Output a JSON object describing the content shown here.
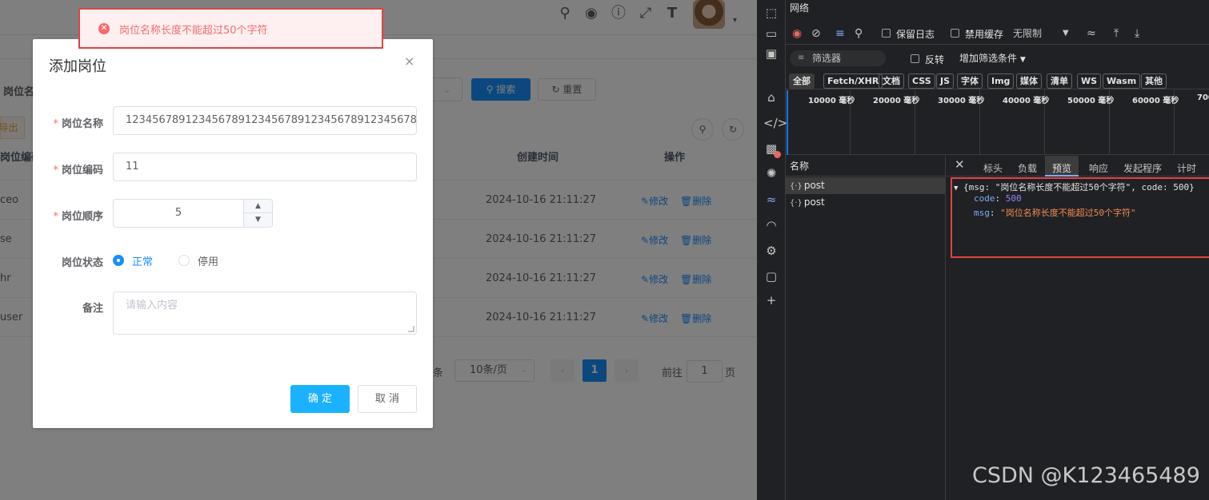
{
  "navbar": {
    "icons": [
      "search-icon",
      "github-icon",
      "question-icon",
      "fullscreen-icon",
      "font-size-icon"
    ],
    "caret": "▾"
  },
  "search": {
    "label": "岗位名",
    "select_arrow": "⌄",
    "search_label": "搜索",
    "reset_label": "重置"
  },
  "toolbar": {
    "export_label": "导出"
  },
  "table": {
    "columns": {
      "code": "岗位编码",
      "created": "创建时间",
      "actions": "操作"
    },
    "edit_label": "修改",
    "delete_label": "删除",
    "rows": [
      {
        "code": "ceo",
        "created": "2024-10-16 21:11:27"
      },
      {
        "code": "se",
        "created": "2024-10-16 21:11:27"
      },
      {
        "code": "hr",
        "created": "2024-10-16 21:11:27"
      },
      {
        "code": "user",
        "created": "2024-10-16 21:11:27"
      }
    ]
  },
  "pagination": {
    "items_suffix": "条",
    "page_size": "10条/页",
    "current": "1",
    "goto_prefix": "前往",
    "goto_value": "1",
    "goto_suffix": "页"
  },
  "dialog": {
    "title": "添加岗位",
    "close": "×",
    "required_mark": "*",
    "fields": {
      "name_label": "岗位名称",
      "name_value": "12345678912345678912345678912345678912345678912345678",
      "code_label": "岗位编码",
      "code_value": "11",
      "order_label": "岗位顺序",
      "order_value": "5",
      "status_label": "岗位状态",
      "status_options": [
        "正常",
        "停用"
      ],
      "status_selected": "正常",
      "remark_label": "备注",
      "remark_placeholder": "请输入内容"
    },
    "confirm_label": "确 定",
    "cancel_label": "取 消"
  },
  "toast": {
    "type": "error",
    "icon": "error-circle-icon",
    "message": "岗位名称长度不能超过50个字符"
  },
  "devtools": {
    "panel_title": "网络",
    "preserve_log": "保留日志",
    "disable_cache": "禁用缓存",
    "throttle": "无限制",
    "filter_placeholder": "筛选器",
    "invert": "反转",
    "more_filters": "增加筛选条件",
    "types": [
      "全部",
      "Fetch/XHR",
      "文档",
      "CSS",
      "JS",
      "字体",
      "Img",
      "媒体",
      "清单",
      "WS",
      "Wasm",
      "其他"
    ],
    "type_selected": "全部",
    "timeline_ticks": [
      "10000 毫秒",
      "20000 毫秒",
      "30000 毫秒",
      "40000 毫秒",
      "50000 毫秒",
      "60000 毫秒",
      "700"
    ],
    "list_header": "名称",
    "requests": [
      "post",
      "post"
    ],
    "detail_tabs": [
      "标头",
      "负载",
      "预览",
      "响应",
      "发起程序",
      "计时"
    ],
    "detail_tab_selected": "预览",
    "preview": {
      "summary": "{msg: \"岗位名称长度不能超过50个字符\", code: 500}",
      "code_key": "code",
      "code_value": "500",
      "msg_key": "msg",
      "msg_value": "\"岗位名称长度不能超过50个字符\""
    }
  },
  "watermark": "CSDN @K123465489",
  "colors": {
    "primary": "#1890ff",
    "danger": "#f56c6c",
    "toast_border": "#e04343",
    "confirm": "#1ab2ff"
  }
}
